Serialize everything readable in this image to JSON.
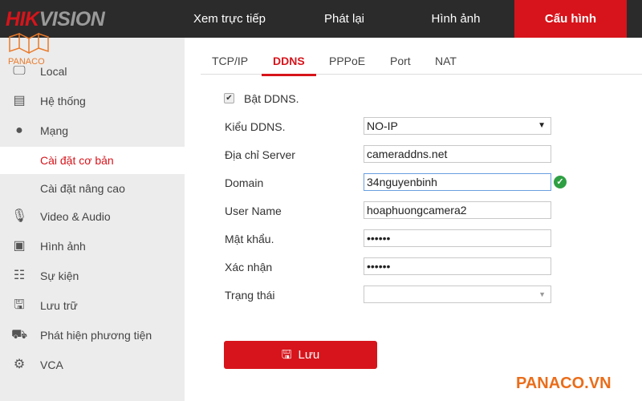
{
  "header": {
    "logo": "HIKVISION",
    "nav": [
      {
        "label": "Xem trực tiếp"
      },
      {
        "label": "Phát lại"
      },
      {
        "label": "Hình ảnh"
      },
      {
        "label": "Cấu hình",
        "active": true
      }
    ],
    "accent": "#d7141b"
  },
  "watermark": {
    "logo_text": "PANACO",
    "footer": "PANACO.VN",
    "color": "#ea6d1a"
  },
  "sidebar": {
    "items": [
      {
        "label": "Local",
        "icon": "monitor-icon"
      },
      {
        "label": "Hệ thống",
        "icon": "system-icon"
      },
      {
        "label": "Mạng",
        "icon": "globe-icon"
      },
      {
        "label": "Cài đặt cơ bản",
        "selected": true
      },
      {
        "label": "Cài đặt nâng cao"
      },
      {
        "label": "Video & Audio",
        "icon": "microphone-icon"
      },
      {
        "label": "Hình ảnh",
        "icon": "image-icon"
      },
      {
        "label": "Sự kiện",
        "icon": "calendar-icon"
      },
      {
        "label": "Lưu trữ",
        "icon": "save-icon"
      },
      {
        "label": "Phát hiện phương tiện",
        "icon": "vehicle-icon"
      },
      {
        "label": "VCA",
        "icon": "vca-icon"
      }
    ]
  },
  "tabs": [
    {
      "label": "TCP/IP"
    },
    {
      "label": "DDNS",
      "active": true
    },
    {
      "label": "PPPoE"
    },
    {
      "label": "Port"
    },
    {
      "label": "NAT"
    }
  ],
  "form": {
    "enable_label": "Bật DDNS.",
    "enable_checked": true,
    "type_label": "Kiểu DDNS.",
    "type_value": "NO-IP",
    "server_label": "Địa chỉ Server",
    "server_value": "cameraddns.net",
    "domain_label": "Domain",
    "domain_value": "34nguyenbinh",
    "user_label": "User Name",
    "user_value": "hoaphuongcamera2",
    "pass_label": "Mật khẩu.",
    "pass_value": "••••••",
    "confirm_label": "Xác nhận",
    "confirm_value": "••••••",
    "status_label": "Trạng thái",
    "status_value": "",
    "save_label": "Lưu"
  }
}
